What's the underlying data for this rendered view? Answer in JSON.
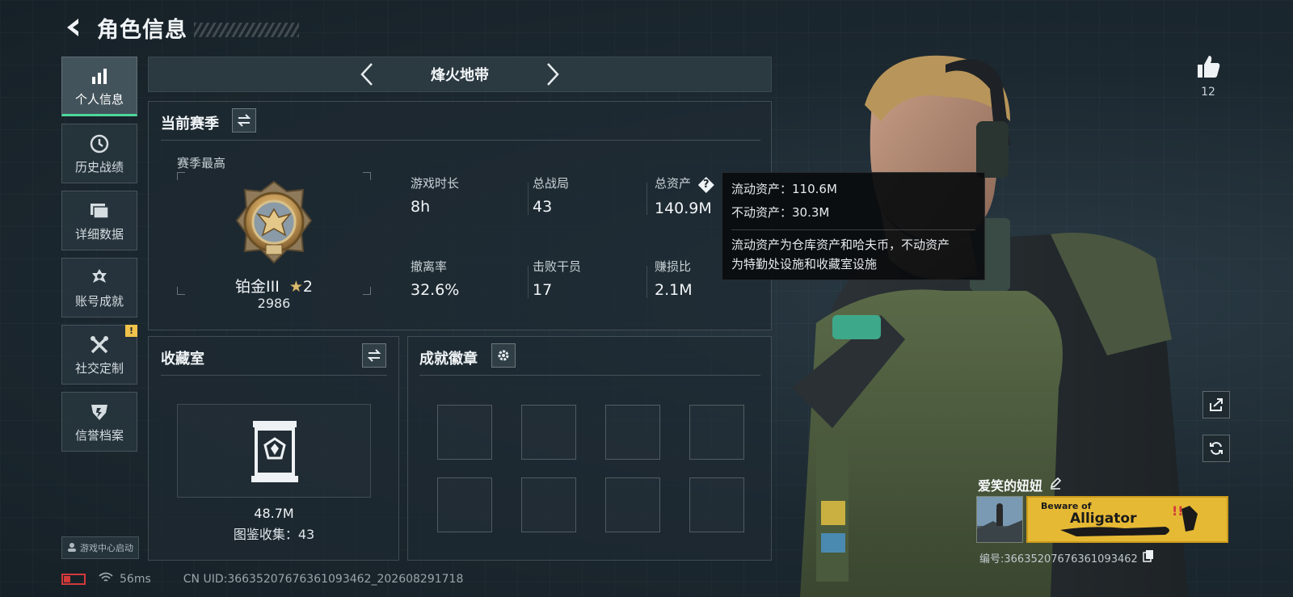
{
  "header": {
    "title": "角色信息"
  },
  "sidebar": {
    "items": [
      {
        "label": "个人信息",
        "icon": "bar-chart-icon",
        "active": true
      },
      {
        "label": "历史战绩",
        "icon": "clock-icon"
      },
      {
        "label": "详细数据",
        "icon": "folder-icon"
      },
      {
        "label": "账号成就",
        "icon": "medal-icon"
      },
      {
        "label": "社交定制",
        "icon": "tools-icon",
        "badge": "!"
      },
      {
        "label": "信誉档案",
        "icon": "shield-icon"
      }
    ],
    "launch_label": "游戏中心启动"
  },
  "mode": {
    "label": "烽火地带"
  },
  "season": {
    "title": "当前赛季",
    "best_label": "赛季最高",
    "rank_name": "铂金III",
    "rank_stars": "2",
    "rank_score": "2986",
    "stats": [
      {
        "label": "游戏时长",
        "value": "8h"
      },
      {
        "label": "总战局",
        "value": "43"
      },
      {
        "label": "总资产",
        "value": "140.9M",
        "help": "?"
      },
      {
        "label": "撤离率",
        "value": "32.6%"
      },
      {
        "label": "击败干员",
        "value": "17"
      },
      {
        "label": "赚损比",
        "value": "2.1M"
      }
    ]
  },
  "tooltip": {
    "liquid": "流动资产：110.6M",
    "fixed": "不动资产：30.3M",
    "desc_line1": "流动资产为仓库资产和哈夫币，不动资产",
    "desc_line2": "为特勤处设施和收藏室设施"
  },
  "collection": {
    "title": "收藏室",
    "value": "48.7M",
    "count": "图鉴收集：43"
  },
  "achievements": {
    "title": "成就徽章"
  },
  "footer": {
    "ping": "56ms",
    "uid": "CN UID:3663520767636109346​2_202608291718"
  },
  "player": {
    "likes": "12",
    "name": "爱笑的妞妞",
    "plate_line1": "Beware of",
    "plate_line2": "Alligator",
    "id": "编号:366352076763610934​62"
  },
  "colors": {
    "accent": "#4fd79a",
    "warning": "#f0c24b",
    "plate": "#e6b935"
  }
}
